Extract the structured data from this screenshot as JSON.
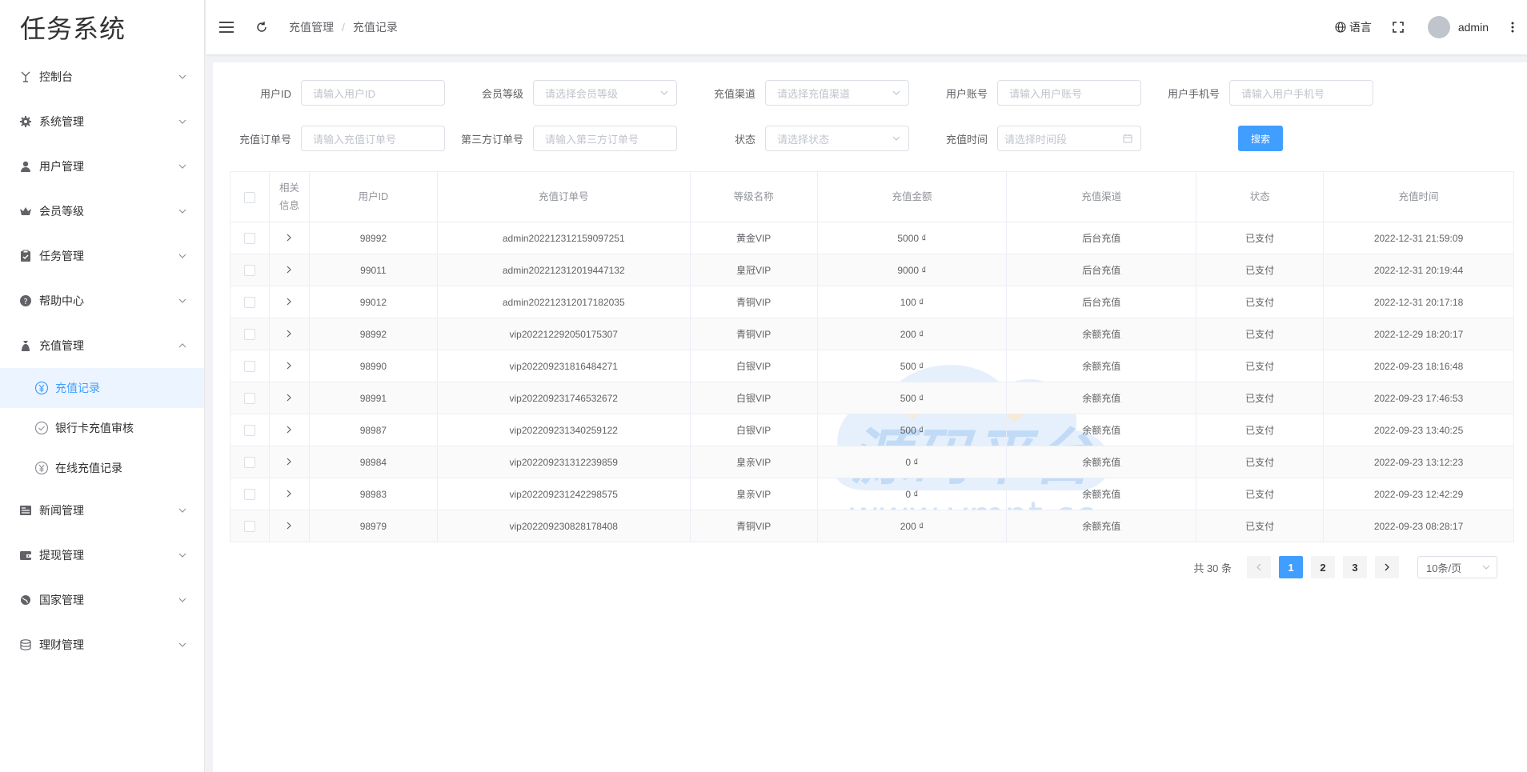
{
  "app": {
    "title": "任务系统"
  },
  "sidebar": {
    "items": [
      {
        "label": "控制台",
        "icon": "dashboard-icon"
      },
      {
        "label": "系统管理",
        "icon": "gear-icon"
      },
      {
        "label": "用户管理",
        "icon": "user-icon"
      },
      {
        "label": "会员等级",
        "icon": "crown-icon"
      },
      {
        "label": "任务管理",
        "icon": "clipboard-icon"
      },
      {
        "label": "帮助中心",
        "icon": "help-icon"
      },
      {
        "label": "充值管理",
        "icon": "money-bag-icon",
        "expanded": true
      },
      {
        "label": "新闻管理",
        "icon": "news-icon"
      },
      {
        "label": "提现管理",
        "icon": "wallet-icon"
      },
      {
        "label": "国家管理",
        "icon": "globe-icon"
      },
      {
        "label": "理财管理",
        "icon": "coins-icon"
      }
    ],
    "subitems": [
      {
        "label": "充值记录",
        "icon": "yen-circle-icon",
        "active": true
      },
      {
        "label": "银行卡充值审核",
        "icon": "check-circle-icon"
      },
      {
        "label": "在线充值记录",
        "icon": "yen-circle-icon"
      }
    ]
  },
  "header": {
    "breadcrumb": [
      "充值管理",
      "充值记录"
    ],
    "breadcrumb_sep": "/",
    "language_label": "语言",
    "username": "admin"
  },
  "filters": {
    "user_id": {
      "label": "用户ID",
      "placeholder": "请输入用户ID"
    },
    "member_level": {
      "label": "会员等级",
      "placeholder": "请选择会员等级"
    },
    "channel": {
      "label": "充值渠道",
      "placeholder": "请选择充值渠道"
    },
    "account": {
      "label": "用户账号",
      "placeholder": "请输入用户账号"
    },
    "phone": {
      "label": "用户手机号",
      "placeholder": "请输入用户手机号"
    },
    "order_no": {
      "label": "充值订单号",
      "placeholder": "请输入充值订单号"
    },
    "third_order_no": {
      "label": "第三方订单号",
      "placeholder": "请输入第三方订单号"
    },
    "status": {
      "label": "状态",
      "placeholder": "请选择状态"
    },
    "time": {
      "label": "充值时间",
      "placeholder": "请选择时间段"
    },
    "search_label": "搜索"
  },
  "table": {
    "headers": [
      "相关\n信息",
      "用户ID",
      "充值订单号",
      "等级名称",
      "充值金额",
      "充值渠道",
      "状态",
      "充值时间"
    ],
    "header_related_1": "相关",
    "header_related_2": "信息",
    "rows": [
      {
        "uid": "98992",
        "order": "admin202212312159097251",
        "level": "黄金VIP",
        "amount": "5000 ₫",
        "channel": "后台充值",
        "status": "已支付",
        "time": "2022-12-31 21:59:09"
      },
      {
        "uid": "99011",
        "order": "admin202212312019447132",
        "level": "皇冠VIP",
        "amount": "9000 ₫",
        "channel": "后台充值",
        "status": "已支付",
        "time": "2022-12-31 20:19:44"
      },
      {
        "uid": "99012",
        "order": "admin202212312017182035",
        "level": "青铜VIP",
        "amount": "100 ₫",
        "channel": "后台充值",
        "status": "已支付",
        "time": "2022-12-31 20:17:18"
      },
      {
        "uid": "98992",
        "order": "vip202212292050175307",
        "level": "青铜VIP",
        "amount": "200 ₫",
        "channel": "余额充值",
        "status": "已支付",
        "time": "2022-12-29 18:20:17"
      },
      {
        "uid": "98990",
        "order": "vip202209231816484271",
        "level": "白银VIP",
        "amount": "500 ₫",
        "channel": "余额充值",
        "status": "已支付",
        "time": "2022-09-23 18:16:48"
      },
      {
        "uid": "98991",
        "order": "vip202209231746532672",
        "level": "白银VIP",
        "amount": "500 ₫",
        "channel": "余额充值",
        "status": "已支付",
        "time": "2022-09-23 17:46:53"
      },
      {
        "uid": "98987",
        "order": "vip202209231340259122",
        "level": "白银VIP",
        "amount": "500 ₫",
        "channel": "余额充值",
        "status": "已支付",
        "time": "2022-09-23 13:40:25"
      },
      {
        "uid": "98984",
        "order": "vip202209231312239859",
        "level": "皇亲VIP",
        "amount": "0 ₫",
        "channel": "余额充值",
        "status": "已支付",
        "time": "2022-09-23 13:12:23"
      },
      {
        "uid": "98983",
        "order": "vip202209231242298575",
        "level": "皇亲VIP",
        "amount": "0 ₫",
        "channel": "余额充值",
        "status": "已支付",
        "time": "2022-09-23 12:42:29"
      },
      {
        "uid": "98979",
        "order": "vip202209230828178408",
        "level": "青铜VIP",
        "amount": "200 ₫",
        "channel": "余额充值",
        "status": "已支付",
        "time": "2022-09-23 08:28:17"
      }
    ]
  },
  "pagination": {
    "total_label": "共 30 条",
    "pages": [
      "1",
      "2",
      "3"
    ],
    "current": "1",
    "page_size": "10条/页"
  },
  "watermark": {
    "text": "源码平台",
    "url": "www.ympt.cc"
  },
  "colors": {
    "accent": "#409eff",
    "active_bg": "#ecf5ff",
    "border": "#ebeef5"
  }
}
